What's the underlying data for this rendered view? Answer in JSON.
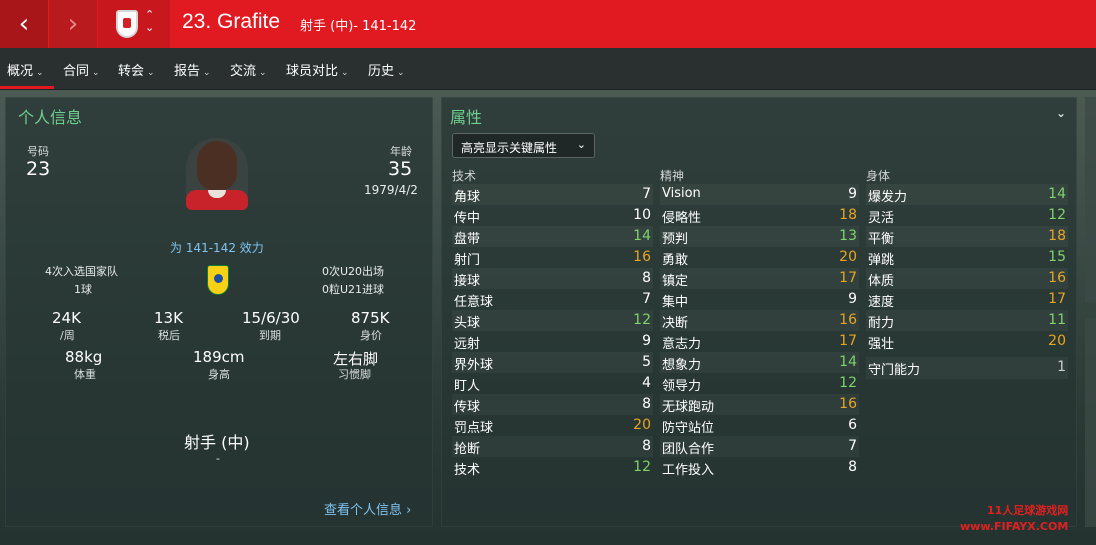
{
  "header": {
    "back_icon": "‹",
    "forward_icon": "›",
    "player_title": "23. Grafite",
    "player_subtitle": "射手 (中)- 141-142"
  },
  "tabs": [
    {
      "label": "概况",
      "active": true
    },
    {
      "label": "合同"
    },
    {
      "label": "转会"
    },
    {
      "label": "报告"
    },
    {
      "label": "交流"
    },
    {
      "label": "球员对比"
    },
    {
      "label": "历史"
    }
  ],
  "personal": {
    "title": "个人信息",
    "number_label": "号码",
    "number": "23",
    "age_label": "年龄",
    "age": "35",
    "dob": "1979/4/2",
    "plays_for": "为 141-142 效力",
    "caps": "4次入选国家队",
    "goals": "1球",
    "u20_caps": "0次U20出场",
    "u21_goals": "0粒U21进球",
    "wage": "24K",
    "wage_label": "/周",
    "after_tax": "13K",
    "after_tax_label": "税后",
    "expiry": "15/6/30",
    "expiry_label": "到期",
    "value": "875K",
    "value_label": "身价",
    "weight": "88kg",
    "weight_label": "体重",
    "height": "189cm",
    "height_label": "身高",
    "foot": "左右脚",
    "foot_label": "习惯脚",
    "position": "射手 (中)",
    "position_sub": "-",
    "view_more": "查看个人信息 ›"
  },
  "attributes": {
    "title": "属性",
    "collapse_icon": "⌄",
    "dropdown": "高亮显示关键属性",
    "technical_label": "技术",
    "mental_label": "精神",
    "physical_label": "身体",
    "technical": [
      {
        "name": "角球",
        "value": "7"
      },
      {
        "name": "传中",
        "value": "10"
      },
      {
        "name": "盘带",
        "value": "14"
      },
      {
        "name": "射门",
        "value": "16"
      },
      {
        "name": "接球",
        "value": "8"
      },
      {
        "name": "任意球",
        "value": "7"
      },
      {
        "name": "头球",
        "value": "12"
      },
      {
        "name": "远射",
        "value": "9"
      },
      {
        "name": "界外球",
        "value": "5"
      },
      {
        "name": "盯人",
        "value": "4"
      },
      {
        "name": "传球",
        "value": "8"
      },
      {
        "name": "罚点球",
        "value": "20"
      },
      {
        "name": "抢断",
        "value": "8"
      },
      {
        "name": "技术",
        "value": "12"
      }
    ],
    "mental": [
      {
        "name": "Vision",
        "value": "9"
      },
      {
        "name": "侵略性",
        "value": "18"
      },
      {
        "name": "预判",
        "value": "13"
      },
      {
        "name": "勇敢",
        "value": "20"
      },
      {
        "name": "镇定",
        "value": "17"
      },
      {
        "name": "集中",
        "value": "9"
      },
      {
        "name": "决断",
        "value": "16"
      },
      {
        "name": "意志力",
        "value": "17"
      },
      {
        "name": "想象力",
        "value": "14"
      },
      {
        "name": "领导力",
        "value": "12"
      },
      {
        "name": "无球跑动",
        "value": "16"
      },
      {
        "name": "防守站位",
        "value": "6"
      },
      {
        "name": "团队合作",
        "value": "7"
      },
      {
        "name": "工作投入",
        "value": "8"
      }
    ],
    "physical": [
      {
        "name": "爆发力",
        "value": "14"
      },
      {
        "name": "灵活",
        "value": "12"
      },
      {
        "name": "平衡",
        "value": "18"
      },
      {
        "name": "弹跳",
        "value": "15"
      },
      {
        "name": "体质",
        "value": "16"
      },
      {
        "name": "速度",
        "value": "17"
      },
      {
        "name": "耐力",
        "value": "11"
      },
      {
        "name": "强壮",
        "value": "20"
      }
    ],
    "goalkeeping": {
      "name": "守门能力",
      "value": "1"
    }
  },
  "colors": {
    "white": "#ffffff",
    "green": "#7ed36a",
    "orange": "#e8a524",
    "accent_red": "#e11a22"
  },
  "watermark": "11人足球游戏网\nwww.FIFAYX.COM"
}
